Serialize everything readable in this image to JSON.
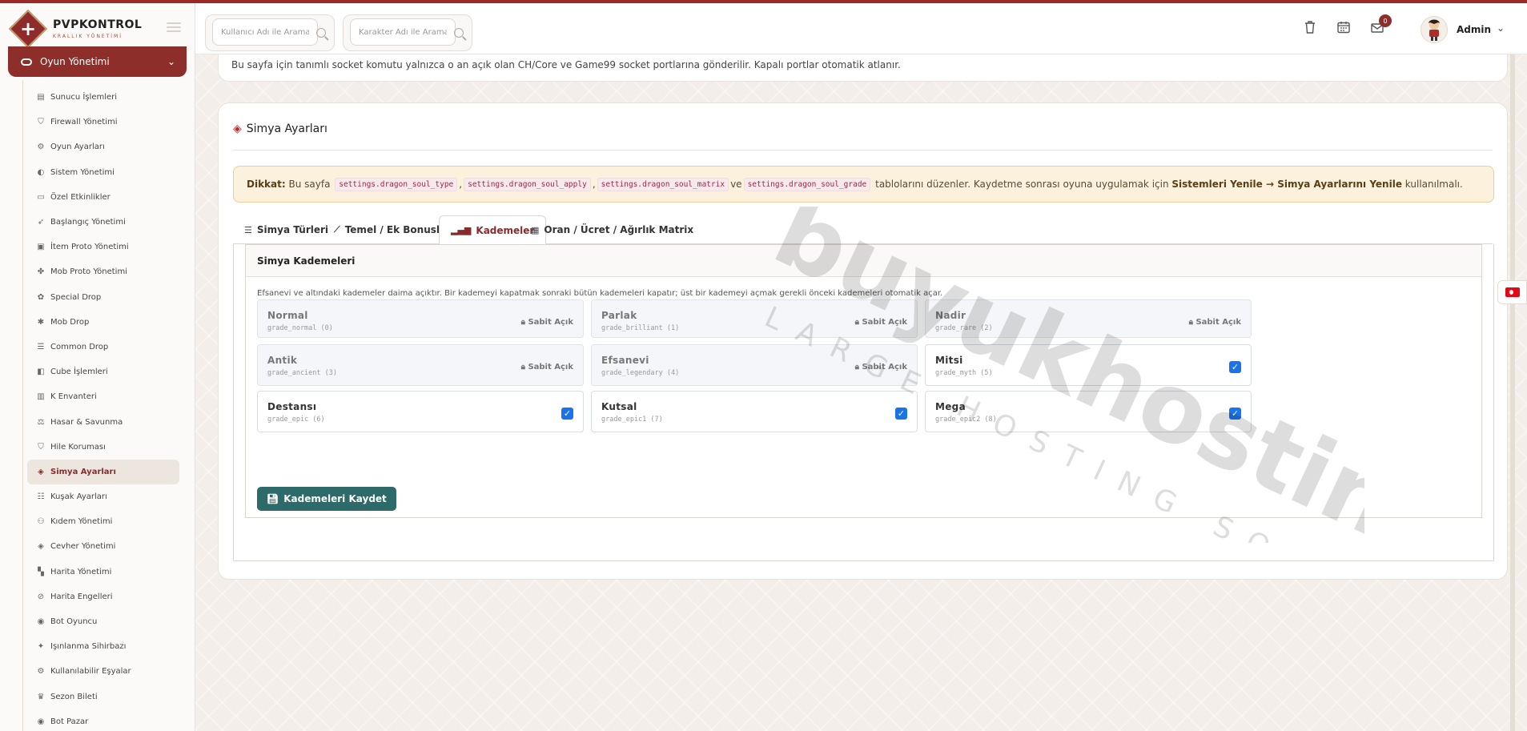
{
  "brand": {
    "title": "PVPKONTROL",
    "subtitle": "KRALLIK YÖNETİMİ"
  },
  "sidebar": {
    "active_group": "Oyun Yönetimi",
    "items": [
      {
        "label": "Sunucu İşlemleri",
        "icon": "server-icon"
      },
      {
        "label": "Firewall Yönetimi",
        "icon": "shield-icon"
      },
      {
        "label": "Oyun Ayarları",
        "icon": "gears-icon"
      },
      {
        "label": "Sistem Yönetimi",
        "icon": "toggle-icon"
      },
      {
        "label": "Özel Etkinlikler",
        "icon": "ticket-icon"
      },
      {
        "label": "Başlangıç Yönetimi",
        "icon": "rocket-icon"
      },
      {
        "label": "İtem Proto Yönetimi",
        "icon": "box-icon"
      },
      {
        "label": "Mob Proto Yönetimi",
        "icon": "paw-icon"
      },
      {
        "label": "Special Drop",
        "icon": "gift-icon"
      },
      {
        "label": "Mob Drop",
        "icon": "bug-icon"
      },
      {
        "label": "Common Drop",
        "icon": "list-icon"
      },
      {
        "label": "Cube İşlemleri",
        "icon": "cube-icon"
      },
      {
        "label": "K Envanteri",
        "icon": "layers-icon"
      },
      {
        "label": "Hasar & Savunma",
        "icon": "scale-icon"
      },
      {
        "label": "Hile Koruması",
        "icon": "shield-icon"
      },
      {
        "label": "Simya Ayarları",
        "icon": "gem-icon",
        "active": true
      },
      {
        "label": "Kuşak Ayarları",
        "icon": "sliders-icon"
      },
      {
        "label": "Kıdem Yönetimi",
        "icon": "users-icon"
      },
      {
        "label": "Cevher Yönetimi",
        "icon": "gem-icon"
      },
      {
        "label": "Harita Yönetimi",
        "icon": "map-icon"
      },
      {
        "label": "Harita Engelleri",
        "icon": "ban-icon"
      },
      {
        "label": "Bot Oyuncu",
        "icon": "robot-icon"
      },
      {
        "label": "Işınlanma Sihirbazı",
        "icon": "wand-icon"
      },
      {
        "label": "Kullanılabilir Eşyalar",
        "icon": "gears-icon"
      },
      {
        "label": "Sezon Bileti",
        "icon": "trophy-icon"
      },
      {
        "label": "Bot Pazar",
        "icon": "robot-icon"
      }
    ]
  },
  "header": {
    "search_user_placeholder": "Kullanıcı Adı ile Arama",
    "search_char_placeholder": "Karakter Adı ile Arama",
    "notification_count": "0",
    "user_name": "Admin"
  },
  "top_notice": "Bu sayfa için tanımlı socket komutu yalnızca o an açık olan CH/Core ve Game99 socket portlarına gönderilir. Kapalı portlar otomatik atlanır.",
  "page": {
    "title": "Simya Ayarları",
    "alert": {
      "prefix": "Dikkat:",
      "text1": "Bu sayfa",
      "codes": [
        "settings.dragon_soul_type",
        "settings.dragon_soul_apply",
        "settings.dragon_soul_matrix",
        "settings.dragon_soul_grade"
      ],
      "sep1": ",",
      "sep2": ",",
      "sep3": "ve",
      "text2": "tablolarını düzenler. Kaydetme sonrası oyuna uygulamak için",
      "bold": "Sistemleri Yenile → Simya Ayarlarını Yenile",
      "text3": "kullanılmalı."
    },
    "tabs": [
      {
        "label": "Simya Türleri",
        "icon": "list-icon"
      },
      {
        "label": "Temel / Ek Bonuslar",
        "icon": "wand-icon"
      },
      {
        "label": "Kademeler",
        "icon": "signal-icon",
        "active": true
      },
      {
        "label": "Oran / Ücret / Ağırlık Matrix",
        "icon": "table-icon"
      }
    ],
    "panel_title": "Simya Kademeleri",
    "hint": "Efsanevi ve altındaki kademeler daima açıktır. Bir kademeyi kapatmak sonraki bütün kademeleri kapatır; üst bir kademeyi açmak gerekli önceki kademeleri otomatik açar.",
    "locked_label": "Sabit Açık",
    "grades": [
      {
        "name": "Normal",
        "key": "grade_normal (0)",
        "locked": true
      },
      {
        "name": "Parlak",
        "key": "grade_brilliant (1)",
        "locked": true
      },
      {
        "name": "Nadir",
        "key": "grade_rare (2)",
        "locked": true
      },
      {
        "name": "Antik",
        "key": "grade_ancient (3)",
        "locked": true
      },
      {
        "name": "Efsanevi",
        "key": "grade_legendary (4)",
        "locked": true
      },
      {
        "name": "Mitsi",
        "key": "grade_myth (5)",
        "locked": false,
        "checked": true
      },
      {
        "name": "Destansı",
        "key": "grade_epic (6)",
        "locked": false,
        "checked": true
      },
      {
        "name": "Kutsal",
        "key": "grade_epic1 (7)",
        "locked": false,
        "checked": true
      },
      {
        "name": "Mega",
        "key": "grade_epic2 (8)",
        "locked": false,
        "checked": true
      }
    ],
    "save_label": "Kademeleri Kaydet"
  },
  "watermark": {
    "main": "buyukhosting",
    "sub": "LARGE HOSTING SOLUTIONS"
  },
  "colors": {
    "brand": "#8d2e2a",
    "accent_teal": "#2d6b6b",
    "alert_bg": "#fbf1dd",
    "checkbox": "#1a73e8"
  }
}
